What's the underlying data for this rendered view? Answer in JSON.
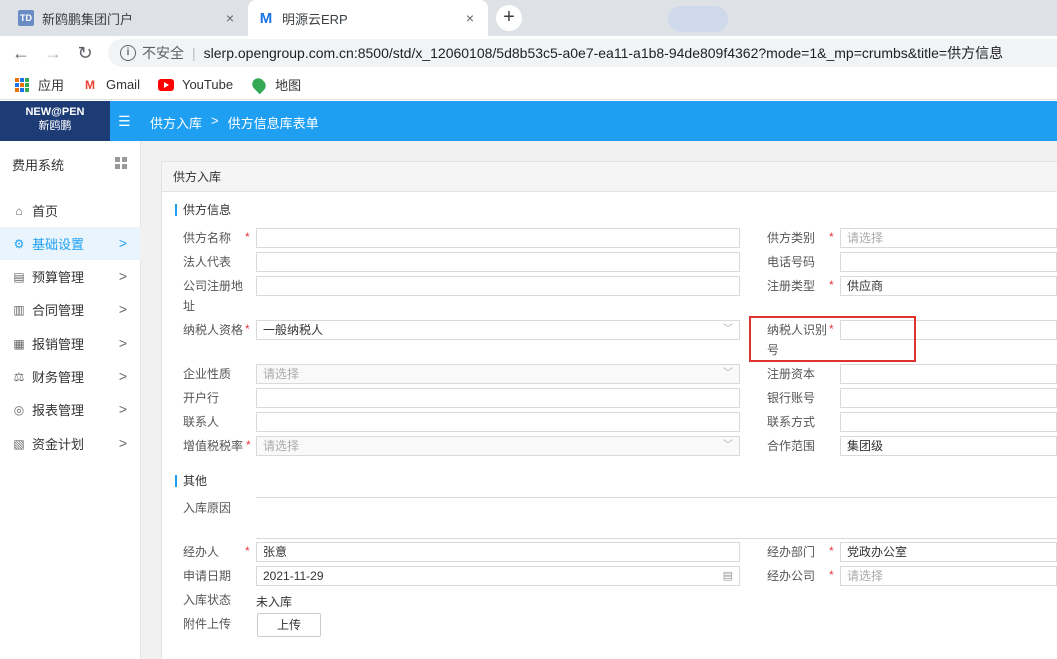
{
  "browser": {
    "tabs": [
      {
        "label": "新鸥鹏集团门户",
        "favicon": "TD"
      },
      {
        "label": "明源云ERP",
        "favicon": "M"
      }
    ],
    "new_tab": "+",
    "close": "×",
    "insecure_label": "不安全",
    "url": "slerp.opengroup.com.cn:8500/std/x_12060108/5d8b53c5-a0e7-ea11-a1b8-94de809f4362?mode=1&_mp=crumbs&title=供方信息"
  },
  "bookmarks": [
    {
      "label": "应用",
      "icon": "apps-grid-icon"
    },
    {
      "label": "Gmail",
      "icon": "gmail-icon"
    },
    {
      "label": "YouTube",
      "icon": "youtube-icon"
    },
    {
      "label": "地图",
      "icon": "maps-icon"
    }
  ],
  "header": {
    "logo_line1": "NEW@PEN",
    "logo_line2": "新鸥鹏",
    "breadcrumb": [
      "供方入库",
      "供方信息库表单"
    ]
  },
  "sidebar": {
    "title": "费用系统",
    "items": [
      {
        "label": "首页",
        "icon": "home-icon",
        "glyph": "⌂",
        "active": false,
        "arrow": false
      },
      {
        "label": "基础设置",
        "icon": "gear-icon",
        "glyph": "⚙",
        "active": true,
        "arrow": true
      },
      {
        "label": "预算管理",
        "icon": "budget-icon",
        "glyph": "▤",
        "active": false,
        "arrow": true
      },
      {
        "label": "合同管理",
        "icon": "contract-icon",
        "glyph": "▥",
        "active": false,
        "arrow": true
      },
      {
        "label": "报销管理",
        "icon": "reimburse-icon",
        "glyph": "▦",
        "active": false,
        "arrow": true
      },
      {
        "label": "财务管理",
        "icon": "finance-icon",
        "glyph": "⚖",
        "active": false,
        "arrow": true
      },
      {
        "label": "报表管理",
        "icon": "report-icon",
        "glyph": "◎",
        "active": false,
        "arrow": true
      },
      {
        "label": "资金计划",
        "icon": "fund-icon",
        "glyph": "▧",
        "active": false,
        "arrow": true
      }
    ]
  },
  "form": {
    "panel_title": "供方入库",
    "section1": "供方信息",
    "section2": "其他",
    "supplier_name": {
      "label": "供方名称",
      "value": ""
    },
    "supplier_type": {
      "label": "供方类别",
      "placeholder": "请选择"
    },
    "legal_rep": {
      "label": "法人代表",
      "value": ""
    },
    "phone": {
      "label": "电话号码",
      "value": ""
    },
    "reg_address": {
      "label_line1": "公司注册地",
      "label_line2": "址",
      "value": ""
    },
    "reg_type": {
      "label": "注册类型",
      "value": "供应商"
    },
    "taxpayer_qual": {
      "label": "纳税人资格",
      "value": "一般纳税人"
    },
    "taxpayer_id": {
      "label_line1": "纳税人识别",
      "label_line2": "号",
      "value": ""
    },
    "enterprise_nature": {
      "label": "企业性质",
      "placeholder": "请选择"
    },
    "reg_capital": {
      "label": "注册资本",
      "value": ""
    },
    "bank": {
      "label": "开户行",
      "value": ""
    },
    "bank_account": {
      "label": "银行账号",
      "value": ""
    },
    "contact": {
      "label": "联系人",
      "value": ""
    },
    "contact_method": {
      "label": "联系方式",
      "value": ""
    },
    "vat_rate": {
      "label": "增值税税率",
      "placeholder": "请选择"
    },
    "coop_scope": {
      "label": "合作范围",
      "value": "集团级"
    },
    "reason": {
      "label": "入库原因",
      "value": ""
    },
    "handler": {
      "label": "经办人",
      "value": "张意"
    },
    "handler_dept": {
      "label": "经办部门",
      "value": "党政办公室"
    },
    "apply_date": {
      "label": "申请日期",
      "value": "2021-11-29"
    },
    "handler_company": {
      "label": "经办公司",
      "placeholder": "请选择"
    },
    "status": {
      "label": "入库状态",
      "value": "未入库"
    },
    "attachment": {
      "label": "附件上传",
      "button": "上传"
    },
    "required_mark": "*"
  }
}
